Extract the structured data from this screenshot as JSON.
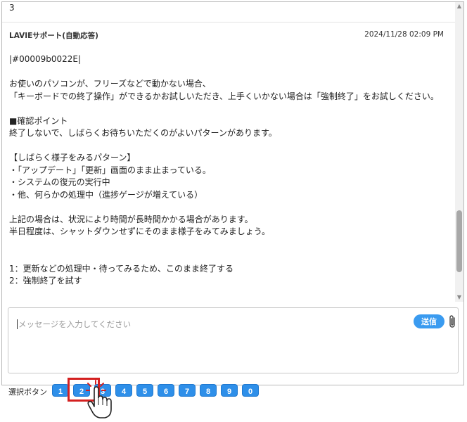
{
  "chat": {
    "previous_line": "3",
    "message": {
      "sender": "LAVIEサポート(自動応答)",
      "timestamp": "2024/11/28 02:09 PM",
      "lines": [
        "|#00009b0022E|",
        "",
        "お使いのパソコンが、フリーズなどで動かない場合、",
        "「キーボードでの終了操作」ができるかお試しいただき、上手くいかない場合は「強制終了」をお試しください。",
        "",
        "■確認ポイント",
        "終了しないで、しばらくお待ちいただくのがよいパターンがあります。",
        "",
        "【しばらく様子をみるパターン】",
        "・「アップデート」「更新」画面のまま止まっている。",
        "・システムの復元の実行中",
        "・他、何らかの処理中（進捗ゲージが増えている）",
        "",
        "上記の場合は、状況により時間が長時間かかる場合があります。",
        "半日程度は、シャットダウンせずにそのまま様子をみてみましょう。",
        "",
        "",
        "1：更新などの処理中・待ってみるため、このまま終了する",
        "2：強制終了を試す"
      ]
    }
  },
  "input": {
    "placeholder": "メッセージを入力してください",
    "send_label": "送信"
  },
  "choices": {
    "label": "選択ボタン",
    "buttons": [
      "1",
      "2",
      "3",
      "4",
      "5",
      "6",
      "7",
      "8",
      "9",
      "0"
    ],
    "selected": "2"
  },
  "colors": {
    "accent": "#2e8fe9",
    "highlight": "#d42020"
  },
  "icons": {
    "attach": "paperclip-icon",
    "pointer": "hand-pointer-icon",
    "scroll_up": "triangle-up-icon",
    "scroll_down": "triangle-down-icon"
  }
}
